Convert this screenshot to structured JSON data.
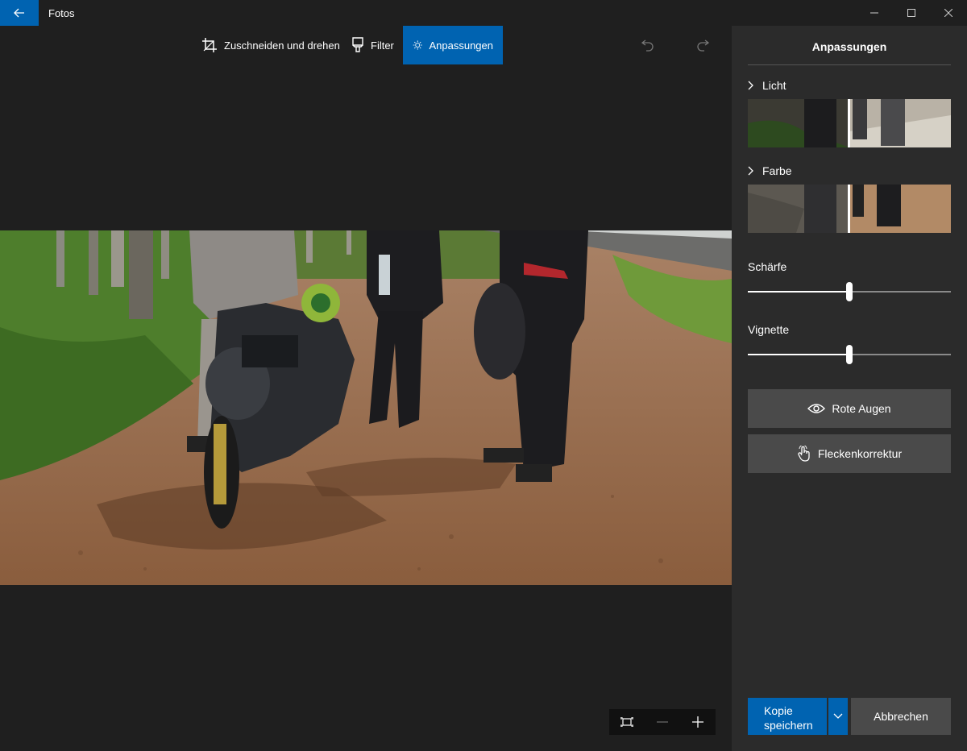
{
  "app": {
    "title": "Fotos"
  },
  "window": {
    "back_icon": "back-arrow-icon",
    "min_icon": "minimize-icon",
    "max_icon": "maximize-icon",
    "close_icon": "close-icon"
  },
  "toolbar": {
    "crop_label": "Zuschneiden und drehen",
    "filter_label": "Filter",
    "adjust_label": "Anpassungen",
    "active_tool": "Anpassungen"
  },
  "panel": {
    "title": "Anpassungen",
    "light_label": "Licht",
    "color_label": "Farbe",
    "sharpness_label": "Schärfe",
    "sharpness_value": 0.5,
    "vignette_label": "Vignette",
    "vignette_value": 0.5,
    "redeye_label": "Rote Augen",
    "spotfix_label": "Fleckenkorrektur",
    "save_label_line1": "Kopie",
    "save_label_line2": "speichern",
    "cancel_label": "Abbrechen"
  },
  "colors": {
    "accent": "#0063b1",
    "panel_bg": "#2b2b2b",
    "canvas_bg": "#1f1f1f",
    "button_bg": "#4a4a4a"
  }
}
